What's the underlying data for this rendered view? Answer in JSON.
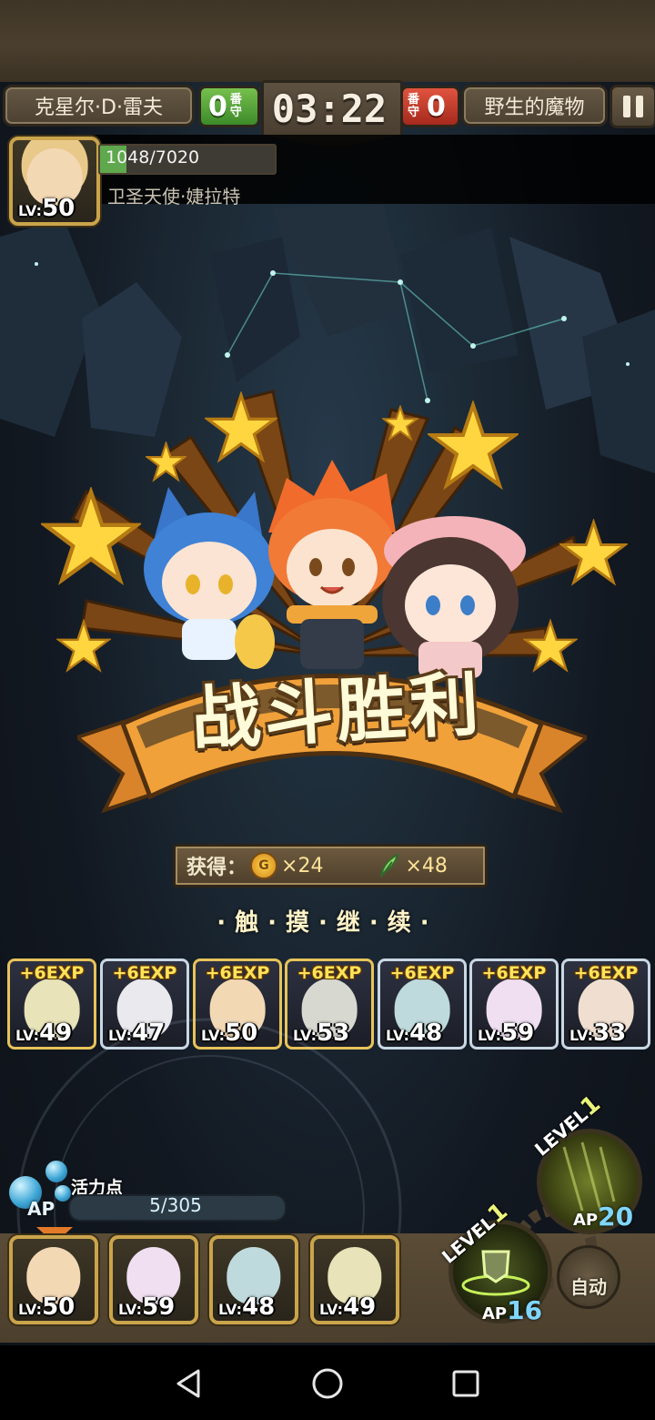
{
  "hud": {
    "player_name": "克星尔·D·雷夫",
    "player_score": "0",
    "player_score_unit": "番守",
    "timer": "03:22",
    "enemy_score": "0",
    "enemy_score_unit": "番守",
    "enemy_name": "野生的魔物"
  },
  "boss": {
    "level": "50",
    "hp_current": 1048,
    "hp_max": 7020,
    "hp_text": "1048/7020",
    "name": "卫圣天使·婕拉特"
  },
  "victory": {
    "title": "战斗胜利",
    "reward_label": "获得：",
    "gold": "×24",
    "feather": "×48",
    "prompt": "·触·摸·继·续·"
  },
  "exp_cards": [
    {
      "exp": "+6EXP",
      "level": "49",
      "frame": "gold",
      "color": "#e8e3b8"
    },
    {
      "exp": "+6EXP",
      "level": "47",
      "frame": "silver",
      "color": "#e9e9ee"
    },
    {
      "exp": "+6EXP",
      "level": "50",
      "frame": "gold",
      "color": "#f3d8b4"
    },
    {
      "exp": "+6EXP",
      "level": "53",
      "frame": "gold",
      "color": "#d7d8d0"
    },
    {
      "exp": "+6EXP",
      "level": "48",
      "frame": "silver",
      "color": "#bfdadc"
    },
    {
      "exp": "+6EXP",
      "level": "59",
      "frame": "silver",
      "color": "#efdff0"
    },
    {
      "exp": "+6EXP",
      "level": "33",
      "frame": "silver",
      "color": "#f0dfd0"
    }
  ],
  "ap": {
    "label": "活力点",
    "tag": "AP",
    "value_text": "5/305",
    "current": 5,
    "max": 305
  },
  "team": [
    {
      "level": "50",
      "color": "#f3d8b4"
    },
    {
      "level": "59",
      "color": "#efdff0"
    },
    {
      "level": "48",
      "color": "#bfdadc"
    },
    {
      "level": "49",
      "color": "#e8e3b8"
    }
  ],
  "skills": {
    "level_tag_1": "LEVEL",
    "level_num_1": "1",
    "ap_cost_1": "16",
    "level_tag_2": "LEVEL",
    "level_num_2": "1",
    "ap_cost_2": "20",
    "ap_prefix": "AP",
    "auto_label": "自动"
  },
  "icons": [
    "pause-icon",
    "coin-icon",
    "feather-icon",
    "back-icon",
    "home-icon",
    "recent-icon",
    "gear-icon",
    "shield-icon"
  ]
}
